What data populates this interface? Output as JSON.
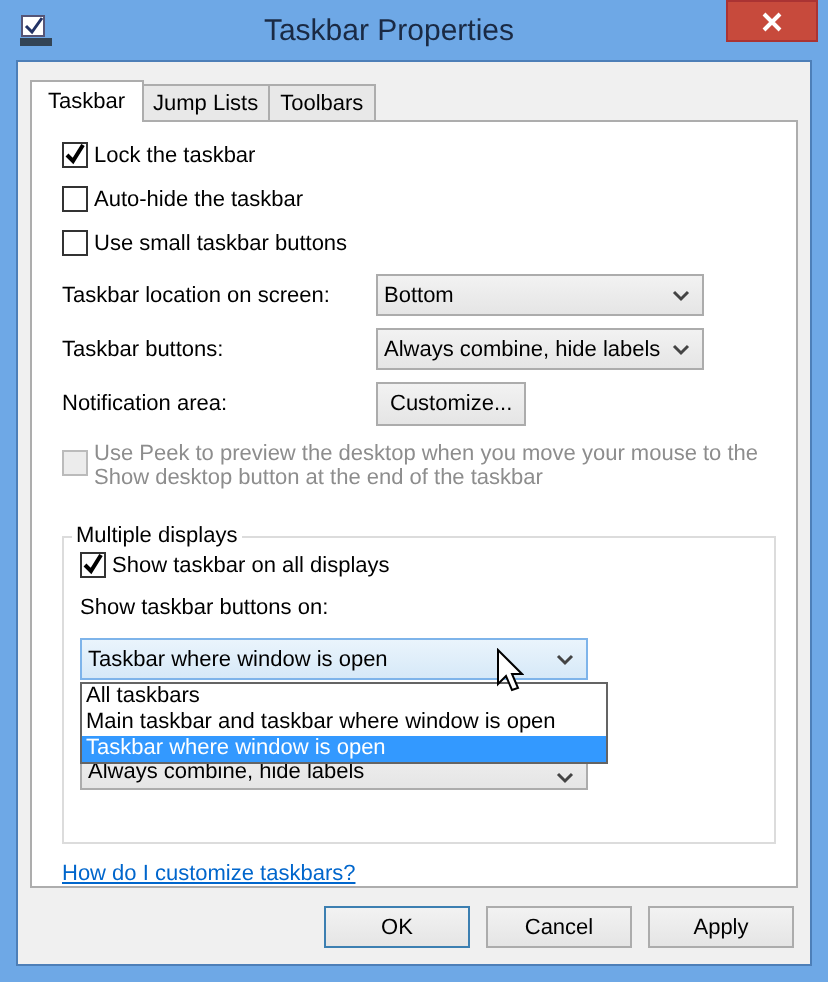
{
  "window": {
    "title": "Taskbar Properties"
  },
  "tabs": [
    {
      "label": "Taskbar",
      "selected": true
    },
    {
      "label": "Jump Lists",
      "selected": false
    },
    {
      "label": "Toolbars",
      "selected": false
    }
  ],
  "options": [
    {
      "label": "Lock the taskbar",
      "checked": true
    },
    {
      "label": "Auto-hide the taskbar",
      "checked": false
    },
    {
      "label": "Use small taskbar buttons",
      "checked": false
    }
  ],
  "settings": [
    {
      "kind": "combo",
      "label": "Taskbar location on screen:",
      "value": "Bottom"
    },
    {
      "kind": "combo",
      "label": "Taskbar buttons:",
      "value": "Always combine, hide labels"
    },
    {
      "kind": "button",
      "label": "Notification area:",
      "value": "Customize..."
    }
  ],
  "peek": {
    "label": "Use Peek to preview the desktop when you move your mouse to the Show desktop button at the end of the taskbar",
    "checked": false,
    "disabled": true
  },
  "multiple_displays": {
    "title": "Multiple displays",
    "show_all": {
      "label": "Show taskbar on all displays",
      "checked": true
    },
    "buttons_on": {
      "label": "Show taskbar buttons on:",
      "value": "Taskbar where window is open",
      "expanded": true,
      "options": [
        {
          "label": "All taskbars",
          "selected": false
        },
        {
          "label": "Main taskbar and taskbar where window is open",
          "selected": false
        },
        {
          "label": "Taskbar where window is open",
          "selected": true
        }
      ]
    },
    "other_taskbar_buttons": {
      "value": "Always combine, hide labels"
    }
  },
  "help_link": "How do I customize taskbars?",
  "buttons": [
    {
      "label": "OK",
      "default": true
    },
    {
      "label": "Cancel",
      "default": false
    },
    {
      "label": "Apply",
      "default": false
    }
  ]
}
